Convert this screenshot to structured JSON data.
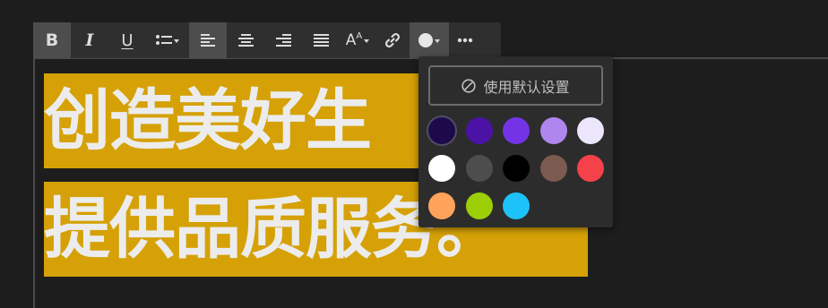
{
  "toolbar": {
    "buttons": [
      {
        "name": "bold-button",
        "icon": "bold-icon",
        "label": "B",
        "active": true
      },
      {
        "name": "italic-button",
        "icon": "italic-icon",
        "label": "I"
      },
      {
        "name": "underline-button",
        "icon": "underline-icon",
        "label": "U"
      },
      {
        "name": "list-button",
        "icon": "bulleted-list-icon"
      },
      {
        "name": "align-left-button",
        "icon": "align-left-icon",
        "active": true
      },
      {
        "name": "align-center-button",
        "icon": "align-center-icon"
      },
      {
        "name": "align-right-button",
        "icon": "align-right-icon"
      },
      {
        "name": "justify-button",
        "icon": "justify-icon"
      },
      {
        "name": "font-size-button",
        "icon": "font-size-icon",
        "label": "A"
      },
      {
        "name": "link-button",
        "icon": "link-icon"
      },
      {
        "name": "text-color-button",
        "icon": "color-circle-icon",
        "open": true
      },
      {
        "name": "more-button",
        "icon": "more-icon"
      }
    ]
  },
  "editor": {
    "lines": [
      "创造美好生",
      "提供品质服务。"
    ],
    "highlight_color": "#d5a106",
    "text_color": "#ececec"
  },
  "color_picker": {
    "default_label": "使用默认设置",
    "default_icon": "ban-icon",
    "swatches": [
      {
        "color": "#1e0a4a",
        "selected": true
      },
      {
        "color": "#4c12a6"
      },
      {
        "color": "#7434e6"
      },
      {
        "color": "#ae86ee"
      },
      {
        "color": "#ece6fc"
      },
      {
        "color": "#ffffff"
      },
      {
        "color": "#4d4d4d"
      },
      {
        "color": "#000000"
      },
      {
        "color": "#7b5a50"
      },
      {
        "color": "#f5424a"
      },
      {
        "color": "#ffa35a"
      },
      {
        "color": "#9ccf07"
      },
      {
        "color": "#1ec2fa"
      }
    ]
  }
}
